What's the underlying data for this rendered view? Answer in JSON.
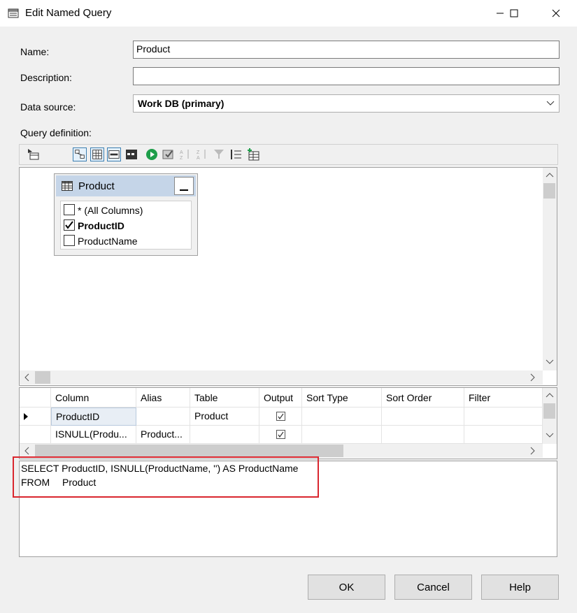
{
  "window": {
    "title": "Edit Named Query"
  },
  "form": {
    "name_label": "Name:",
    "name_value": "Product",
    "description_label": "Description:",
    "description_value": "",
    "datasource_label": "Data source:",
    "datasource_value": "Work DB (primary)",
    "query_def_label": "Query definition:"
  },
  "diagram": {
    "table_title": "Product",
    "columns": [
      {
        "label": "* (All Columns)",
        "checked": false
      },
      {
        "label": "ProductID",
        "checked": true
      },
      {
        "label": "ProductName",
        "checked": false
      }
    ]
  },
  "grid": {
    "headers": [
      "Column",
      "Alias",
      "Table",
      "Output",
      "Sort Type",
      "Sort Order",
      "Filter"
    ],
    "rows": [
      {
        "column": "ProductID",
        "alias": "",
        "table": "Product",
        "output": true,
        "current": true
      },
      {
        "column": "ISNULL(Produ...",
        "alias": "Product...",
        "table": "",
        "output": true,
        "current": false
      }
    ]
  },
  "sql": {
    "line1": "SELECT ProductID, ISNULL(ProductName, '') AS ProductName",
    "line2_kw": "FROM",
    "line2_tbl": "Product"
  },
  "buttons": {
    "ok": "OK",
    "cancel": "Cancel",
    "help": "Help"
  },
  "colors": {
    "highlight_box": "#d9262e",
    "selected_toolbar": "#3c7fb1"
  }
}
